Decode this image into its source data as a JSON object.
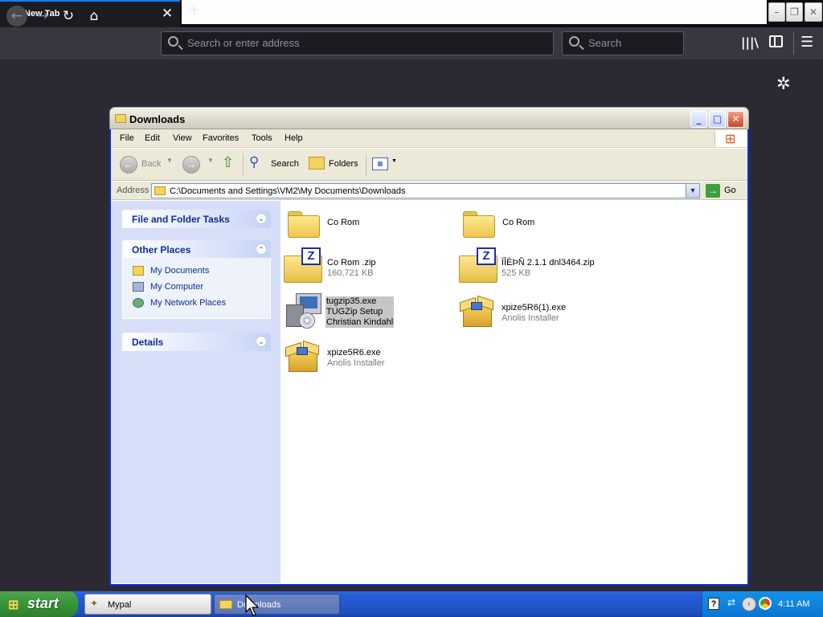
{
  "browser": {
    "tab_title": "New Tab",
    "tab_close": "✕",
    "new_tab": "+",
    "url_placeholder": "Search or enter address",
    "search_placeholder": "Search"
  },
  "explorer": {
    "title": "Downloads",
    "menu": [
      "File",
      "Edit",
      "View",
      "Favorites",
      "Tools",
      "Help"
    ],
    "toolbar": {
      "back": "Back",
      "search": "Search",
      "folders": "Folders"
    },
    "address_label": "Address",
    "address_value": "C:\\Documents and Settings\\VM2\\My Documents\\Downloads",
    "go_label": "Go",
    "tasks": {
      "file_folder_tasks": "File and Folder Tasks",
      "other_places": "Other Places",
      "places": [
        "My Documents",
        "My Computer",
        "My Network Places"
      ],
      "details": "Details"
    },
    "files": [
      {
        "name": "Co Rom",
        "sub1": "",
        "sub2": "",
        "type": "folder"
      },
      {
        "name": "Co Rom",
        "sub1": "",
        "sub2": "",
        "type": "folder"
      },
      {
        "name": "Co Rom .zip",
        "sub1": "160,721 KB",
        "sub2": "",
        "type": "zip"
      },
      {
        "name": "ÏÎÈÞÑ 2.1.1 dnl3464.zip",
        "sub1": "525 KB",
        "sub2": "",
        "type": "zip"
      },
      {
        "name": "tugzip35.exe",
        "sub1": "TUGZip Setup",
        "sub2": "Christian Kindahl",
        "type": "setup",
        "selected": true
      },
      {
        "name": "xpize5R6(1).exe",
        "sub1": "Anolis Installer",
        "sub2": "",
        "type": "installer"
      },
      {
        "name": "xpize5R6.exe",
        "sub1": "Anolis Installer",
        "sub2": "",
        "type": "installer"
      }
    ]
  },
  "taskbar": {
    "start": "start",
    "tasks": [
      "Mypal",
      "Downloads"
    ],
    "clock": "4:11 AM"
  }
}
